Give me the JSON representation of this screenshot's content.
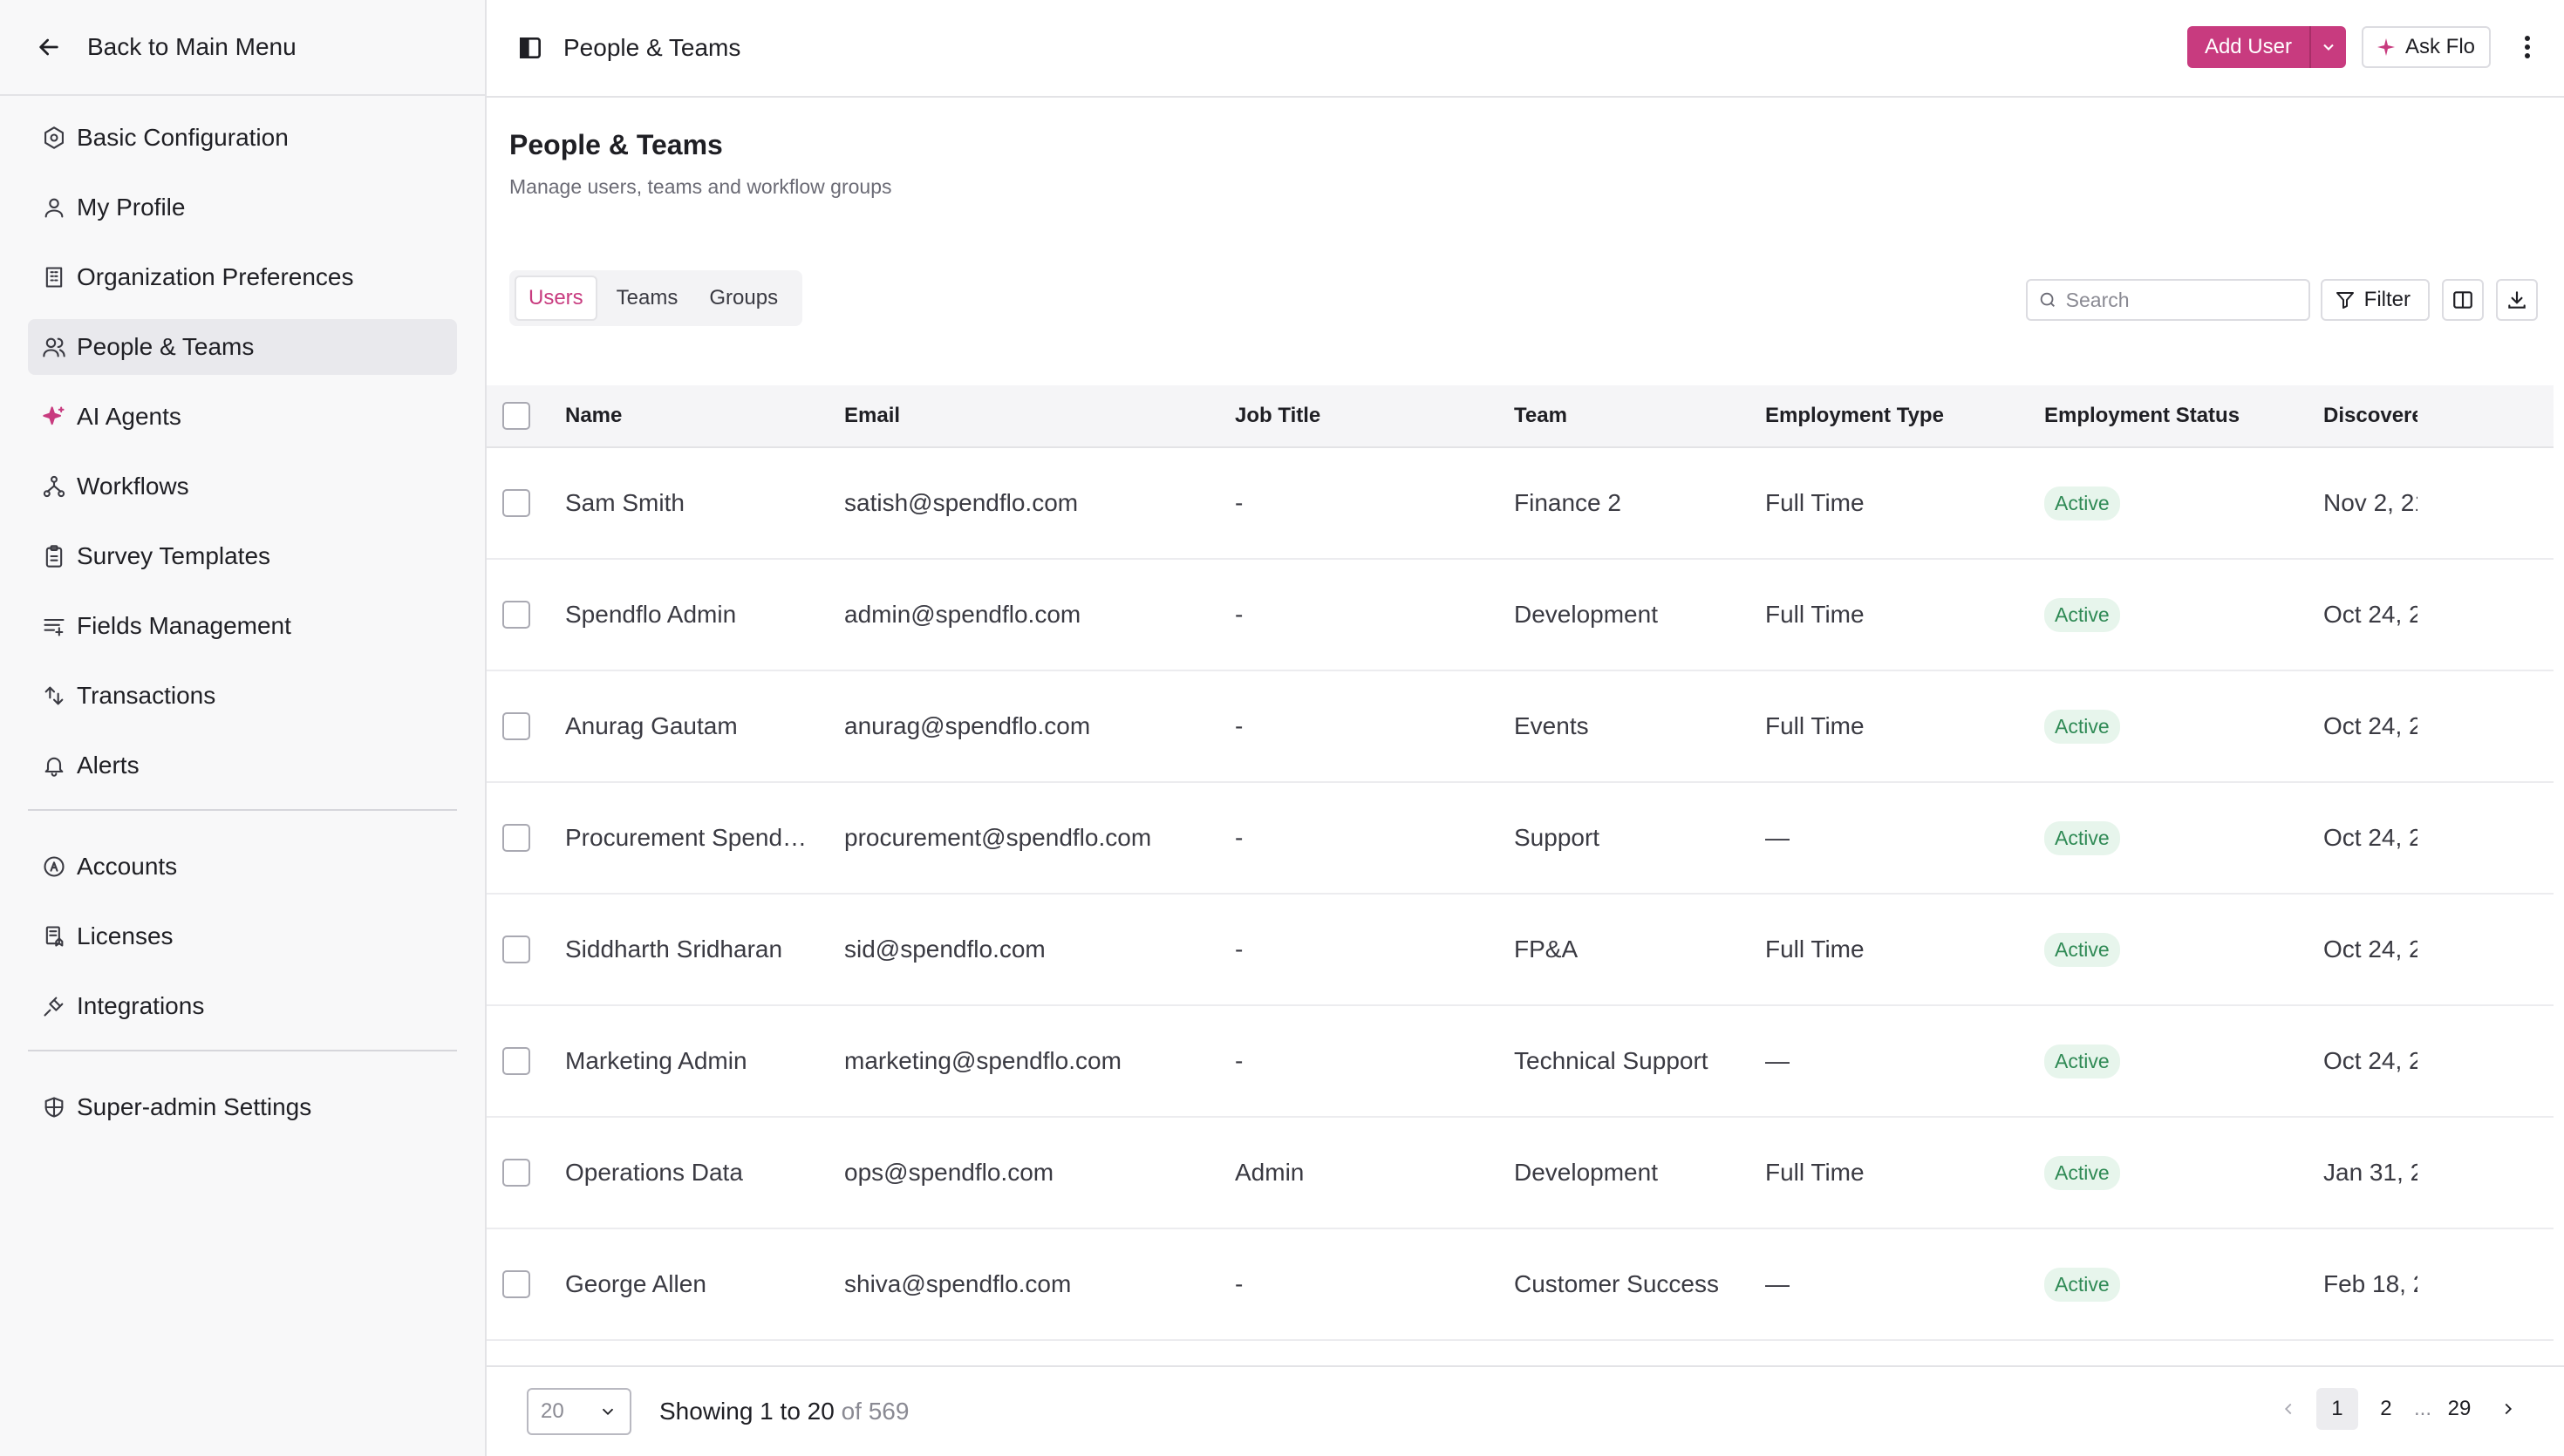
{
  "sidebar": {
    "back_label": "Back to Main Menu",
    "group1": [
      {
        "label": "Basic Configuration",
        "icon": "hexagon-gear-icon"
      },
      {
        "label": "My Profile",
        "icon": "user-icon"
      },
      {
        "label": "Organization Preferences",
        "icon": "building-icon"
      },
      {
        "label": "People & Teams",
        "icon": "users-icon",
        "active": true
      },
      {
        "label": "AI Agents",
        "icon": "sparkles-icon"
      },
      {
        "label": "Workflows",
        "icon": "workflow-icon"
      },
      {
        "label": "Survey Templates",
        "icon": "clipboard-icon"
      },
      {
        "label": "Fields Management",
        "icon": "list-filter-icon"
      },
      {
        "label": "Transactions",
        "icon": "transactions-icon"
      },
      {
        "label": "Alerts",
        "icon": "bell-icon"
      }
    ],
    "group2": [
      {
        "label": "Accounts",
        "icon": "circle-a-icon"
      },
      {
        "label": "Licenses",
        "icon": "license-icon"
      },
      {
        "label": "Integrations",
        "icon": "plug-icon"
      }
    ],
    "group3": [
      {
        "label": "Super-admin Settings",
        "icon": "shield-icon"
      }
    ]
  },
  "topbar": {
    "breadcrumb": "People & Teams",
    "add_user_label": "Add User",
    "ask_label": "Ask Flo"
  },
  "page": {
    "title": "People & Teams",
    "subtitle": "Manage users, teams and workflow groups"
  },
  "tabs": [
    {
      "label": "Users",
      "active": true
    },
    {
      "label": "Teams",
      "active": false
    },
    {
      "label": "Groups",
      "active": false
    }
  ],
  "toolbar": {
    "search_placeholder": "Search",
    "filter_label": "Filter"
  },
  "table": {
    "columns": [
      "Name",
      "Email",
      "Job Title",
      "Team",
      "Employment Type",
      "Employment Status",
      "Discovere"
    ],
    "rows": [
      {
        "name": "Sam Smith",
        "email": "satish@spendflo.com",
        "job": "-",
        "team": "Finance 2",
        "emp": "Full Time",
        "status": "Active",
        "disc": "Nov 2, 21"
      },
      {
        "name": "Spendflo Admin",
        "email": "admin@spendflo.com",
        "job": "-",
        "team": "Development",
        "emp": "Full Time",
        "status": "Active",
        "disc": "Oct 24, 2"
      },
      {
        "name": "Anurag Gautam",
        "email": "anurag@spendflo.com",
        "job": "-",
        "team": "Events",
        "emp": "Full Time",
        "status": "Active",
        "disc": "Oct 24, 2"
      },
      {
        "name": "Procurement Spendf...",
        "email": "procurement@spendflo.com",
        "job": "-",
        "team": "Support",
        "emp": "—",
        "status": "Active",
        "disc": "Oct 24, 2"
      },
      {
        "name": "Siddharth Sridharan",
        "email": "sid@spendflo.com",
        "job": "-",
        "team": "FP&A",
        "emp": "Full Time",
        "status": "Active",
        "disc": "Oct 24, 2"
      },
      {
        "name": "Marketing Admin",
        "email": "marketing@spendflo.com",
        "job": "-",
        "team": "Technical Support",
        "emp": "—",
        "status": "Active",
        "disc": "Oct 24, 2"
      },
      {
        "name": "Operations Data",
        "email": "ops@spendflo.com",
        "job": "Admin",
        "team": "Development",
        "emp": "Full Time",
        "status": "Active",
        "disc": "Jan 31, 2"
      },
      {
        "name": "George Allen",
        "email": "shiva@spendflo.com",
        "job": "-",
        "team": "Customer Success",
        "emp": "—",
        "status": "Active",
        "disc": "Feb 18, 2"
      }
    ]
  },
  "footer": {
    "page_size": "20",
    "showing_prefix": "Showing 1 to 20",
    "showing_suffix": "of 569",
    "pages": [
      "1",
      "2",
      "...",
      "29"
    ],
    "current_page": "1"
  },
  "colors": {
    "accent": "#c83b7f",
    "active_badge_bg": "#e7f5ec",
    "active_badge_text": "#2f8a55"
  }
}
